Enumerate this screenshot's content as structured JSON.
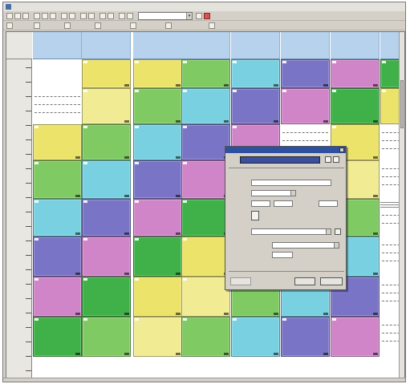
{
  "window": {
    "title": ""
  },
  "toolbar": {
    "combo_value": ""
  },
  "columns": [
    {
      "label": ""
    },
    {
      "label": ""
    },
    {
      "label": ""
    },
    {
      "label": ""
    },
    {
      "label": ""
    },
    {
      "label": ""
    },
    {
      "label": ""
    },
    {
      "label": ""
    }
  ],
  "colors": {
    "yellow": "#ece36a",
    "green": "#3fb148",
    "lightgreen": "#7fca63",
    "cyan": "#79d0e1",
    "purple": "#7a74c7",
    "pink": "#cf85c8",
    "paleyellow": "#f1ec93",
    "header": "#b6d2ec",
    "dialog_title": "#2f4f9f"
  },
  "dialog": {
    "title": "",
    "selected": "",
    "ok_label": "",
    "cancel_label": "",
    "help_label": ""
  }
}
